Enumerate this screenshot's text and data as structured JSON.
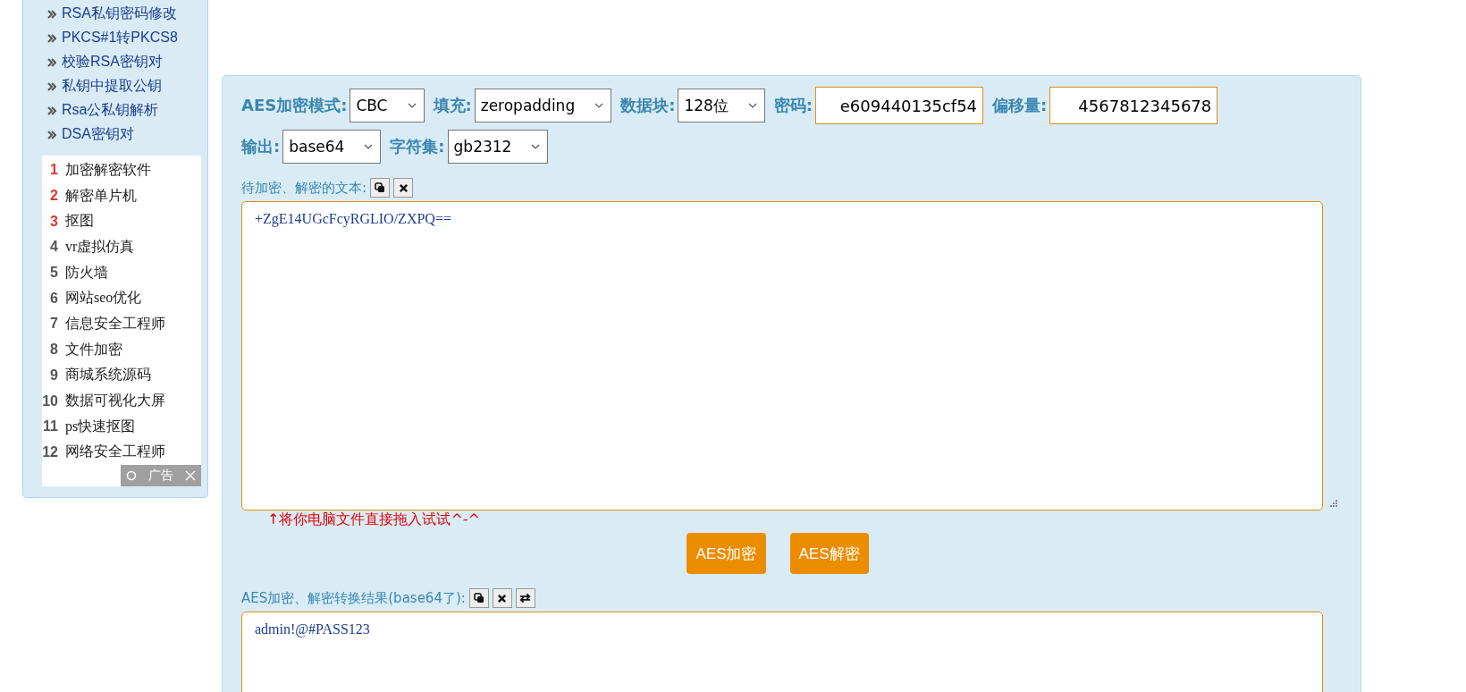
{
  "sidebar": {
    "links": [
      {
        "label": "RSA私钥密码修改"
      },
      {
        "label": "PKCS#1转PKCS8"
      },
      {
        "label": "校验RSA密钥对"
      },
      {
        "label": "私钥中提取公钥"
      },
      {
        "label": "Rsa公私钥解析"
      },
      {
        "label": "DSA密钥对"
      }
    ],
    "ranking": [
      {
        "rank": "1",
        "label": "加密解密软件",
        "color": "#d9392f"
      },
      {
        "rank": "2",
        "label": "解密单片机",
        "color": "#d9392f"
      },
      {
        "rank": "3",
        "label": "抠图",
        "color": "#d9392f"
      },
      {
        "rank": "4",
        "label": "vr虚拟仿真",
        "color": "#555555"
      },
      {
        "rank": "5",
        "label": "防火墙",
        "color": "#555555"
      },
      {
        "rank": "6",
        "label": "网站seo优化",
        "color": "#555555"
      },
      {
        "rank": "7",
        "label": "信息安全工程师",
        "color": "#555555"
      },
      {
        "rank": "8",
        "label": "文件加密",
        "color": "#555555"
      },
      {
        "rank": "9",
        "label": "商城系统源码",
        "color": "#555555"
      },
      {
        "rank": "10",
        "label": "数据可视化大屏",
        "color": "#555555"
      },
      {
        "rank": "11",
        "label": "ps快速抠图",
        "color": "#555555"
      },
      {
        "rank": "12",
        "label": "网络安全工程师",
        "color": "#555555"
      }
    ],
    "ad_badge": {
      "label": "广告"
    }
  },
  "settings": [
    {
      "kind": "select",
      "label": "AES加密模式:",
      "value": "CBC"
    },
    {
      "kind": "select",
      "label": "填充:",
      "value": "zeropadding"
    },
    {
      "kind": "select",
      "label": "数据块:",
      "value": "128位"
    },
    {
      "kind": "input",
      "label": "密码:",
      "value": "e609440135cf54"
    },
    {
      "kind": "input",
      "label": "偏移量:",
      "value": "4567812345678"
    },
    {
      "kind": "select",
      "label": "输出:",
      "value": "base64"
    },
    {
      "kind": "select",
      "label": "字符集:",
      "value": "gb2312"
    }
  ],
  "input_section": {
    "label": "待加密、解密的文本:",
    "value": "+ZgE14UGcFcyRGLIO/ZXPQ==",
    "hint": "↑将你电脑文件直接拖入试试^-^"
  },
  "buttons": [
    "AES加密",
    "AES解密"
  ],
  "output_section": {
    "label": "AES加密、解密转换结果(base64了):",
    "value": "admin!@#PASS123"
  }
}
